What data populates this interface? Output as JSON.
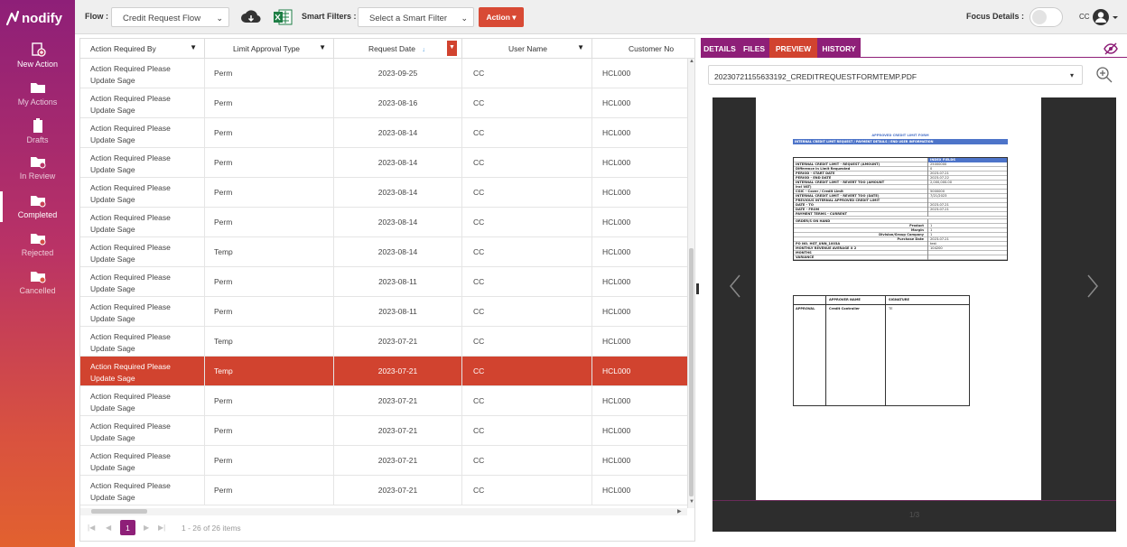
{
  "app": {
    "logo_text": "nodify"
  },
  "sidebar": {
    "items": [
      {
        "label": "New Action",
        "icon": "new-action-icon"
      },
      {
        "label": "My Actions",
        "icon": "folder-icon"
      },
      {
        "label": "Drafts",
        "icon": "clipboard-icon"
      },
      {
        "label": "In Review",
        "icon": "folder-review-icon"
      },
      {
        "label": "Completed",
        "icon": "folder-check-icon"
      },
      {
        "label": "Rejected",
        "icon": "folder-x-icon"
      },
      {
        "label": "Cancelled",
        "icon": "folder-cancel-icon"
      }
    ],
    "active": "Completed"
  },
  "toolbar": {
    "flow_label": "Flow :",
    "flow_value": "Credit Request Flow",
    "smart_filters_label": "Smart Filters :",
    "smart_filter_placeholder": "Select a Smart Filter",
    "action_label": "Action",
    "focus_label": "Focus Details :",
    "user_initials": "CC"
  },
  "grid": {
    "columns": [
      "Action Required By",
      "Limit Approval Type",
      "Request Date",
      "User Name",
      "Customer No"
    ],
    "rows": [
      {
        "ar1": "Action Required Please",
        "ar2": "Update Sage",
        "type": "Perm",
        "date": "2023-09-25",
        "user": "CC",
        "cust": "HCL000"
      },
      {
        "ar1": "Action Required Please",
        "ar2": "Update Sage",
        "type": "Perm",
        "date": "2023-08-16",
        "user": "CC",
        "cust": "HCL000"
      },
      {
        "ar1": "Action Required Please",
        "ar2": "Update Sage",
        "type": "Perm",
        "date": "2023-08-14",
        "user": "CC",
        "cust": "HCL000"
      },
      {
        "ar1": "Action Required Please",
        "ar2": "Update Sage",
        "type": "Perm",
        "date": "2023-08-14",
        "user": "CC",
        "cust": "HCL000"
      },
      {
        "ar1": "Action Required Please",
        "ar2": "Update Sage",
        "type": "Perm",
        "date": "2023-08-14",
        "user": "CC",
        "cust": "HCL000"
      },
      {
        "ar1": "Action Required Please",
        "ar2": "Update Sage",
        "type": "Perm",
        "date": "2023-08-14",
        "user": "CC",
        "cust": "HCL000"
      },
      {
        "ar1": "Action Required Please",
        "ar2": "Update Sage",
        "type": "Temp",
        "date": "2023-08-14",
        "user": "CC",
        "cust": "HCL000"
      },
      {
        "ar1": "Action Required Please",
        "ar2": "Update Sage",
        "type": "Perm",
        "date": "2023-08-11",
        "user": "CC",
        "cust": "HCL000"
      },
      {
        "ar1": "Action Required Please",
        "ar2": "Update Sage",
        "type": "Perm",
        "date": "2023-08-11",
        "user": "CC",
        "cust": "HCL000"
      },
      {
        "ar1": "Action Required Please",
        "ar2": "Update Sage",
        "type": "Temp",
        "date": "2023-07-21",
        "user": "CC",
        "cust": "HCL000"
      },
      {
        "ar1": "Action Required Please",
        "ar2": "Update Sage",
        "type": "Temp",
        "date": "2023-07-21",
        "user": "CC",
        "cust": "HCL000",
        "selected": true
      },
      {
        "ar1": "Action Required Please",
        "ar2": "Update Sage",
        "type": "Perm",
        "date": "2023-07-21",
        "user": "CC",
        "cust": "HCL000"
      },
      {
        "ar1": "Action Required Please",
        "ar2": "Update Sage",
        "type": "Perm",
        "date": "2023-07-21",
        "user": "CC",
        "cust": "HCL000"
      },
      {
        "ar1": "Action Required Please",
        "ar2": "Update Sage",
        "type": "Perm",
        "date": "2023-07-21",
        "user": "CC",
        "cust": "HCL000"
      },
      {
        "ar1": "Action Required Please",
        "ar2": "Update Sage",
        "type": "Perm",
        "date": "2023-07-21",
        "user": "CC",
        "cust": "HCL000"
      }
    ],
    "pager": {
      "current_page": "1",
      "summary": "1 - 26 of 26 items"
    }
  },
  "preview": {
    "tabs": [
      "DETAILS",
      "FILES",
      "PREVIEW",
      "HISTORY"
    ],
    "active_tab": "PREVIEW",
    "file_name": "20230721155633192_CREDITREQUESTFORMTEMP.PDF",
    "page_counter": "1/3",
    "doc": {
      "title": "APPROVED CREDIT LIMIT FORM",
      "band": "INTERNAL CREDIT LIMIT REQUEST / PAYMENT DETAILS / END USER INFORMATION",
      "index_header": "INDEX FIELDS",
      "fields": [
        {
          "k": "INTERNAL CREDIT LIMIT - REQUEST (AMOUNT)",
          "v": "25000000"
        },
        {
          "k": "Difference in Limit Requested",
          "v": "0"
        },
        {
          "k": "PERIOD - START DATE",
          "v": "2023-07-21"
        },
        {
          "k": "PERIOD - END DATE",
          "v": "2023-07-22"
        },
        {
          "k": "INTERNAL CREDIT LIMIT - REVERT TOO (AMOUNT",
          "v": "2,000,000.00"
        },
        {
          "k": "incl VAT)",
          "v": ""
        },
        {
          "k": "CGIC - Cover / Credit Limit",
          "v": "5000000"
        },
        {
          "k": "INTERNAL CREDIT LIMIT - REVERT TOO (DATE)",
          "v": "7/21/2023"
        },
        {
          "k": "PREVIOUS INTERNAL APPROVED CREDIT LIMIT",
          "v": ""
        },
        {
          "k": "DATE - TO",
          "v": "2023-07-21"
        },
        {
          "k": "DATE - FROM",
          "v": "2023-07-21"
        },
        {
          "k": "PAYMENT TERMS - CURRENT",
          "v": ""
        }
      ],
      "orders_label": "ORDER/S ON HAND",
      "order_fields": [
        {
          "k": "Product",
          "v": "1"
        },
        {
          "k": "Margin",
          "v": "1"
        },
        {
          "k": "Division/Group Company",
          "v": "1"
        },
        {
          "k": "Purchase Date",
          "v": "2023-07-21"
        }
      ],
      "po_fields": [
        {
          "k": "PO NO. HGT_UNN_1003A",
          "v": "test"
        },
        {
          "k": "MONTHLY REVENUE AVERAGE X 2",
          "v": "104200"
        },
        {
          "k": "MONTHS",
          "v": ""
        },
        {
          "k": "VARIANCE",
          "v": ""
        }
      ],
      "sign_headers": [
        "APPROVER NAME",
        "SIGNATURE"
      ],
      "approval_label": "APPROVAL",
      "approver": "Credit Controller",
      "signature": "TE"
    }
  },
  "colors": {
    "brand_purple": "#8e1f78",
    "accent_red": "#d1432f",
    "excel_green": "#1e7e45"
  }
}
